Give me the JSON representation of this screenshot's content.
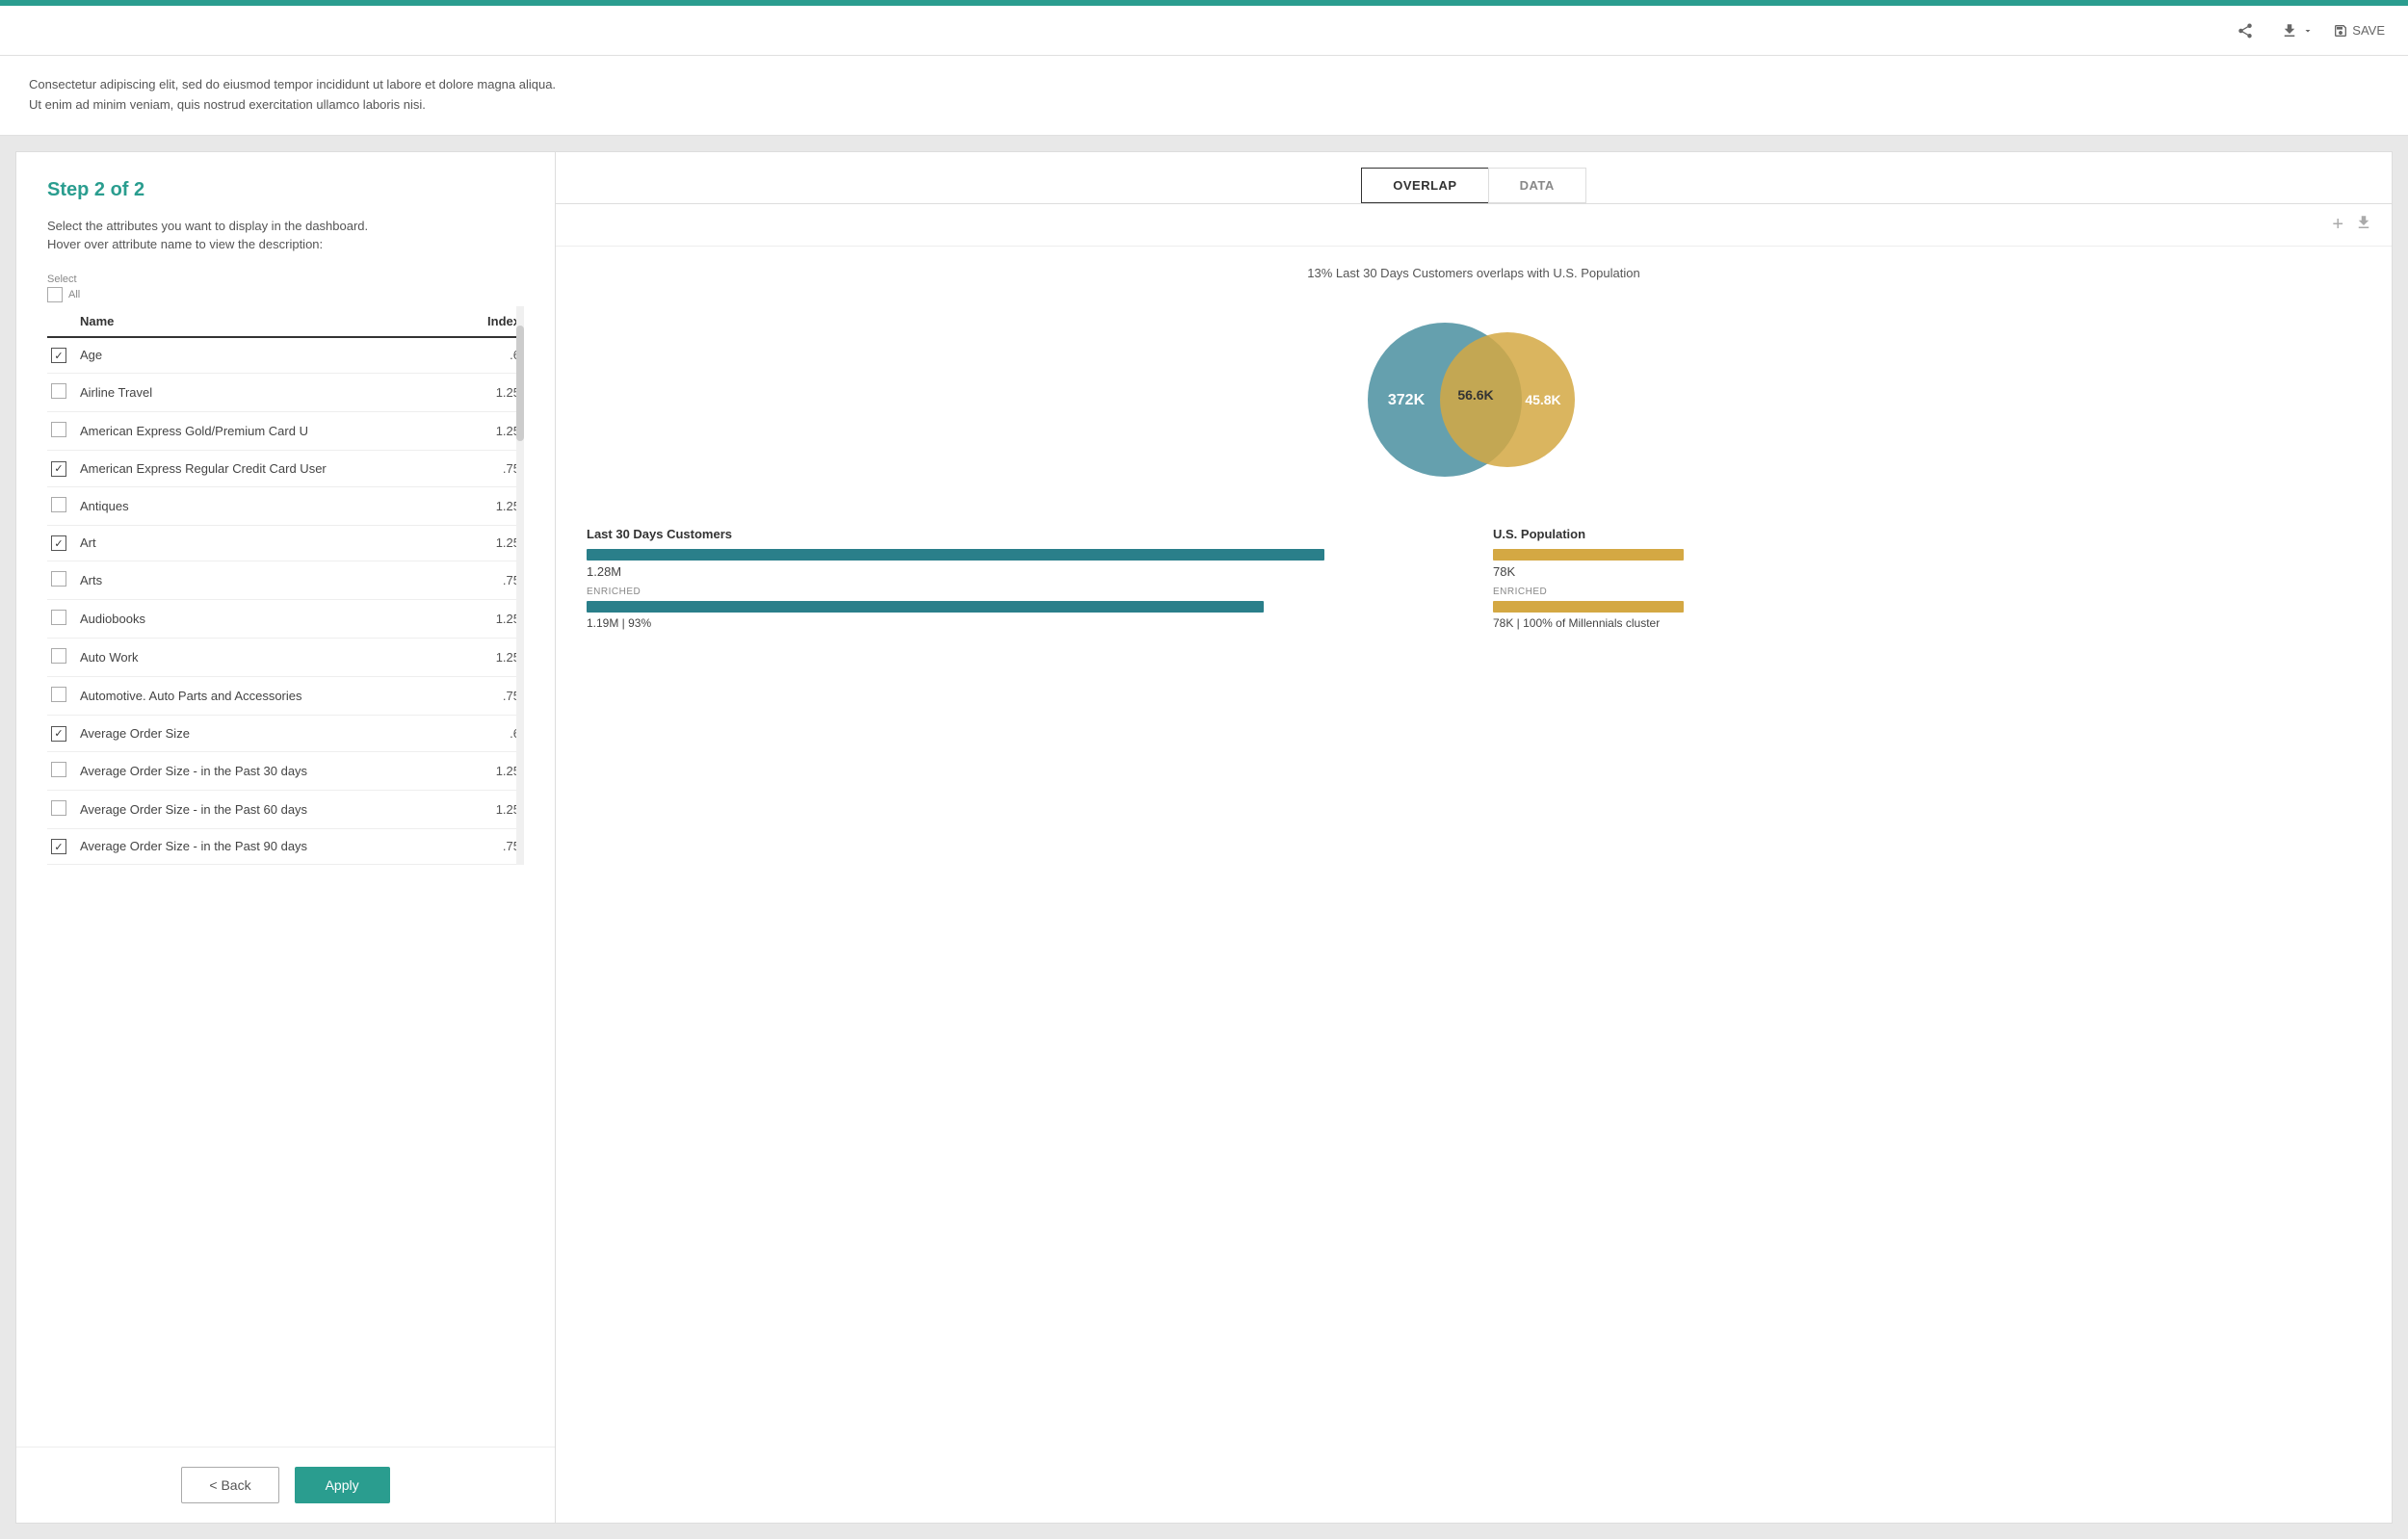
{
  "topbar": {
    "color": "#2a9d8f"
  },
  "toolbar": {
    "share_label": "SAVE",
    "save_icon": "save-icon",
    "download_icon": "download-icon",
    "share_icon": "share-icon"
  },
  "description": {
    "line1": "Consectetur adipiscing elit, sed do eiusmod tempor incididunt ut labore et dolore magna aliqua.",
    "line2": "Ut enim ad minim veniam, quis nostrud exercitation ullamco laboris nisi."
  },
  "left_panel": {
    "step_title": "Step 2 of 2",
    "instruction_line1": "Select the attributes you want to display in the dashboard.",
    "instruction_line2": "Hover over attribute name to view the description:",
    "select_label": "Select",
    "all_label": "All",
    "table": {
      "col_name": "Name",
      "col_index": "Index",
      "rows": [
        {
          "name": "Age",
          "index": ".6",
          "checked": true
        },
        {
          "name": "Airline Travel",
          "index": "1.25",
          "checked": false
        },
        {
          "name": "American Express Gold/Premium Card U",
          "index": "1.25",
          "checked": false
        },
        {
          "name": "American Express Regular Credit Card User",
          "index": ".75",
          "checked": true
        },
        {
          "name": "Antiques",
          "index": "1.25",
          "checked": false
        },
        {
          "name": "Art",
          "index": "1.25",
          "checked": true
        },
        {
          "name": "Arts",
          "index": ".75",
          "checked": false
        },
        {
          "name": "Audiobooks",
          "index": "1.25",
          "checked": false
        },
        {
          "name": "Auto Work",
          "index": "1.25",
          "checked": false
        },
        {
          "name": "Automotive. Auto Parts and Accessories",
          "index": ".75",
          "checked": false
        },
        {
          "name": "Average Order Size",
          "index": ".6",
          "checked": true
        },
        {
          "name": "Average Order Size - in the Past 30 days",
          "index": "1.25",
          "checked": false
        },
        {
          "name": "Average Order Size - in the Past 60 days",
          "index": "1.25",
          "checked": false
        },
        {
          "name": "Average Order Size - in the Past 90 days",
          "index": ".75",
          "checked": true
        }
      ]
    },
    "back_label": "< Back",
    "apply_label": "Apply"
  },
  "right_panel": {
    "tabs": [
      {
        "label": "OVERLAP",
        "active": true
      },
      {
        "label": "DATA",
        "active": false
      }
    ],
    "chart": {
      "title": "13% Last 30 Days Customers overlaps with U.S. Population",
      "venn": {
        "left_value": "372K",
        "center_value": "56.6K",
        "right_value": "45.8K",
        "left_color": "#4a8fa0",
        "right_color": "#d4a843",
        "overlap_color": "#7a9a7a"
      },
      "left_group": {
        "title": "Last 30 Days Customers",
        "bar_width_pct": 85,
        "value": "1.28M",
        "enriched_label": "Enriched",
        "enriched_bar_width_pct": 80,
        "enriched_value": "1.19M | 93%"
      },
      "right_group": {
        "title": "U.S. Population",
        "bar_width_pct": 20,
        "value": "78K",
        "enriched_label": "ENRICHED",
        "enriched_bar_width_pct": 20,
        "enriched_value": "78K | 100% of Millennials cluster"
      }
    }
  }
}
